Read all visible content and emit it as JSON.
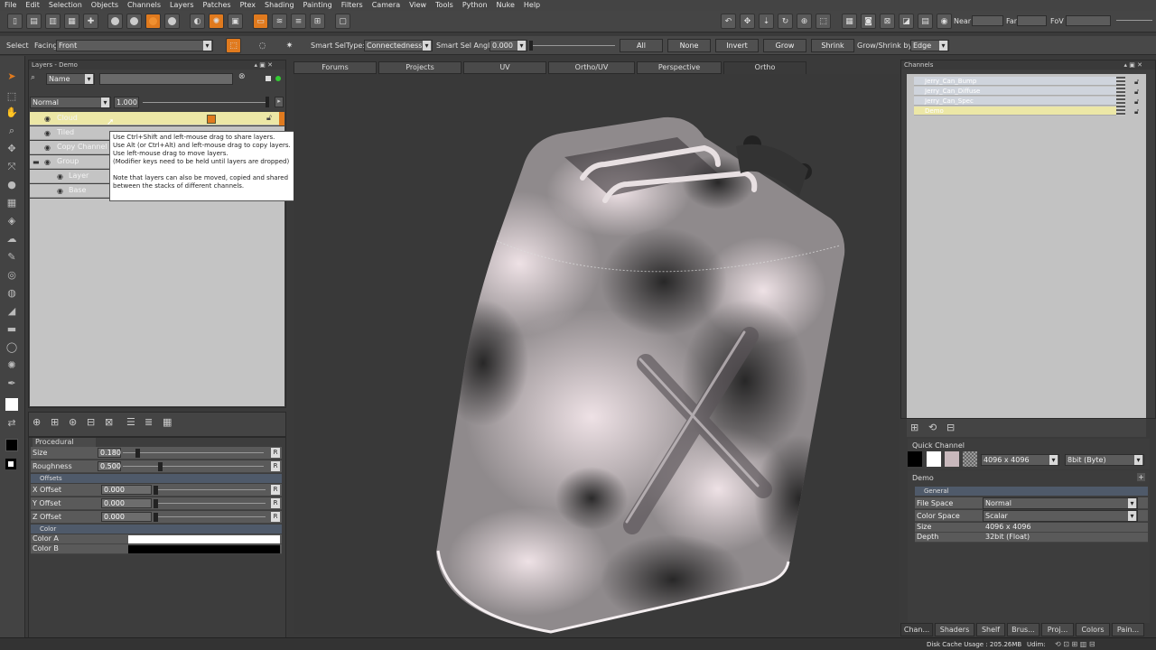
{
  "menu": [
    "File",
    "Edit",
    "Selection",
    "Objects",
    "Channels",
    "Layers",
    "Patches",
    "Ptex",
    "Shading",
    "Painting",
    "Filters",
    "Camera",
    "View",
    "Tools",
    "Python",
    "Nuke",
    "Help"
  ],
  "camera": {
    "near_label": "Near",
    "far_label": "Far",
    "fov_label": "FoV"
  },
  "selection_bar": {
    "select_label": "Select",
    "facing_label": "Facing",
    "facing_value": "Front",
    "smart_seltype_label": "Smart SelType:",
    "smart_seltype_value": "Connectedness",
    "smart_angle_label": "Smart Sel Angle",
    "smart_angle_value": "0.000",
    "all": "All",
    "none": "None",
    "invert": "Invert",
    "grow": "Grow",
    "shrink": "Shrink",
    "grow_shrink_label": "Grow/Shrink by",
    "grow_shrink_value": "Edge"
  },
  "layers_panel": {
    "title": "Layers - Demo",
    "filter_value": "Name",
    "blend_mode": "Normal",
    "opacity": "1.000",
    "rows": [
      {
        "name": "Cloud",
        "selected": true
      },
      {
        "name": "Tiled"
      },
      {
        "name": "Copy Channel"
      },
      {
        "name": "Group"
      },
      {
        "name": "Layer"
      },
      {
        "name": "Base"
      }
    ]
  },
  "tooltip": {
    "lines": [
      "Use Ctrl+Shift and left-mouse drag to share layers.",
      "Use Alt (or Ctrl+Alt) and left-mouse drag to copy layers.",
      "Use left-mouse drag to move layers.",
      "(Modifier keys need to be held until layers are dropped)",
      "",
      "Note that layers can also be moved, copied and shared",
      "between the stacks of different channels."
    ]
  },
  "procedural": {
    "title": "Procedural",
    "size_label": "Size",
    "size_value": "0.180",
    "size_level": 0.09,
    "roughness_label": "Roughness",
    "roughness_value": "0.500",
    "roughness_level": 0.25,
    "offsets_label": "Offsets",
    "x_label": "X Offset",
    "x_value": "0.000",
    "y_label": "Y Offset",
    "y_value": "0.000",
    "z_label": "Z Offset",
    "z_value": "0.000",
    "color_label": "Color",
    "color_a_label": "Color A",
    "color_a": "#ffffff",
    "color_b_label": "Color B",
    "color_b": "#000000",
    "reset": "R"
  },
  "view_tabs": [
    "Forums",
    "Projects",
    "UV",
    "Ortho/UV",
    "Perspective",
    "Ortho"
  ],
  "channels_panel": {
    "title": "Channels",
    "items": [
      {
        "name": "Jerry_Can_Bump"
      },
      {
        "name": "Jerry_Can_Diffuse"
      },
      {
        "name": "Jerry_Can_Spec"
      },
      {
        "name": "Demo",
        "selected": true
      }
    ]
  },
  "quick_channel": {
    "title": "Quick Channel",
    "resolution": "4096 x 4096",
    "depth": "8bit  (Byte)"
  },
  "demo_props": {
    "title": "Demo",
    "general": "General",
    "file_space_label": "File Space",
    "file_space": "Normal",
    "color_space_label": "Color Space",
    "color_space": "Scalar",
    "size_label": "Size",
    "size": "4096 x 4096",
    "depth_label": "Depth",
    "depth": "32bit (Float)"
  },
  "bottom_tabs": [
    "Chan...",
    "Shaders",
    "Shelf",
    "Brus...",
    "Proj...",
    "Colors",
    "Pain..."
  ],
  "status": {
    "disk_cache": "Disk Cache Usage : 205.26MB",
    "udim": "Udim:"
  },
  "colors": {
    "accent": "#e07a1e",
    "selection": "#ece7a6"
  }
}
